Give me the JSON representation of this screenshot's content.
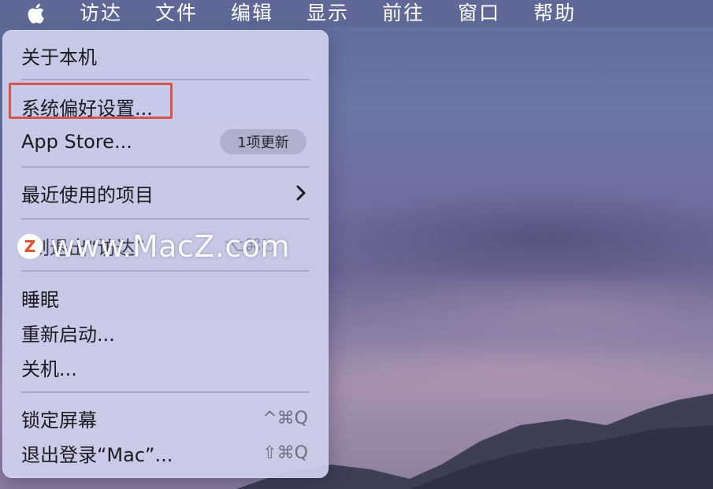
{
  "menubar": {
    "apple_icon": "apple-logo-icon",
    "items": [
      {
        "label": "访达"
      },
      {
        "label": "文件"
      },
      {
        "label": "编辑"
      },
      {
        "label": "显示"
      },
      {
        "label": "前往"
      },
      {
        "label": "窗口"
      },
      {
        "label": "帮助"
      }
    ]
  },
  "apple_menu": {
    "about": "关于本机",
    "system_preferences": "系统偏好设置...",
    "app_store": "App Store...",
    "app_store_badge": "1项更新",
    "recent_items": "最近使用的项目",
    "force_quit_partial": "制退出“访达”",
    "force_quit_shortcut": "⌥⌘⎋",
    "sleep": "睡眠",
    "restart": "重新启动...",
    "shutdown": "关机...",
    "lock_screen": "锁定屏幕",
    "lock_screen_shortcut": "^⌘Q",
    "log_out": "退出登录“Mac”...",
    "log_out_shortcut": "⇧⌘Q",
    "highlight_color": "#d9534a"
  },
  "watermark": {
    "logo_letter": "Z",
    "text": "www.MacZ.com"
  }
}
